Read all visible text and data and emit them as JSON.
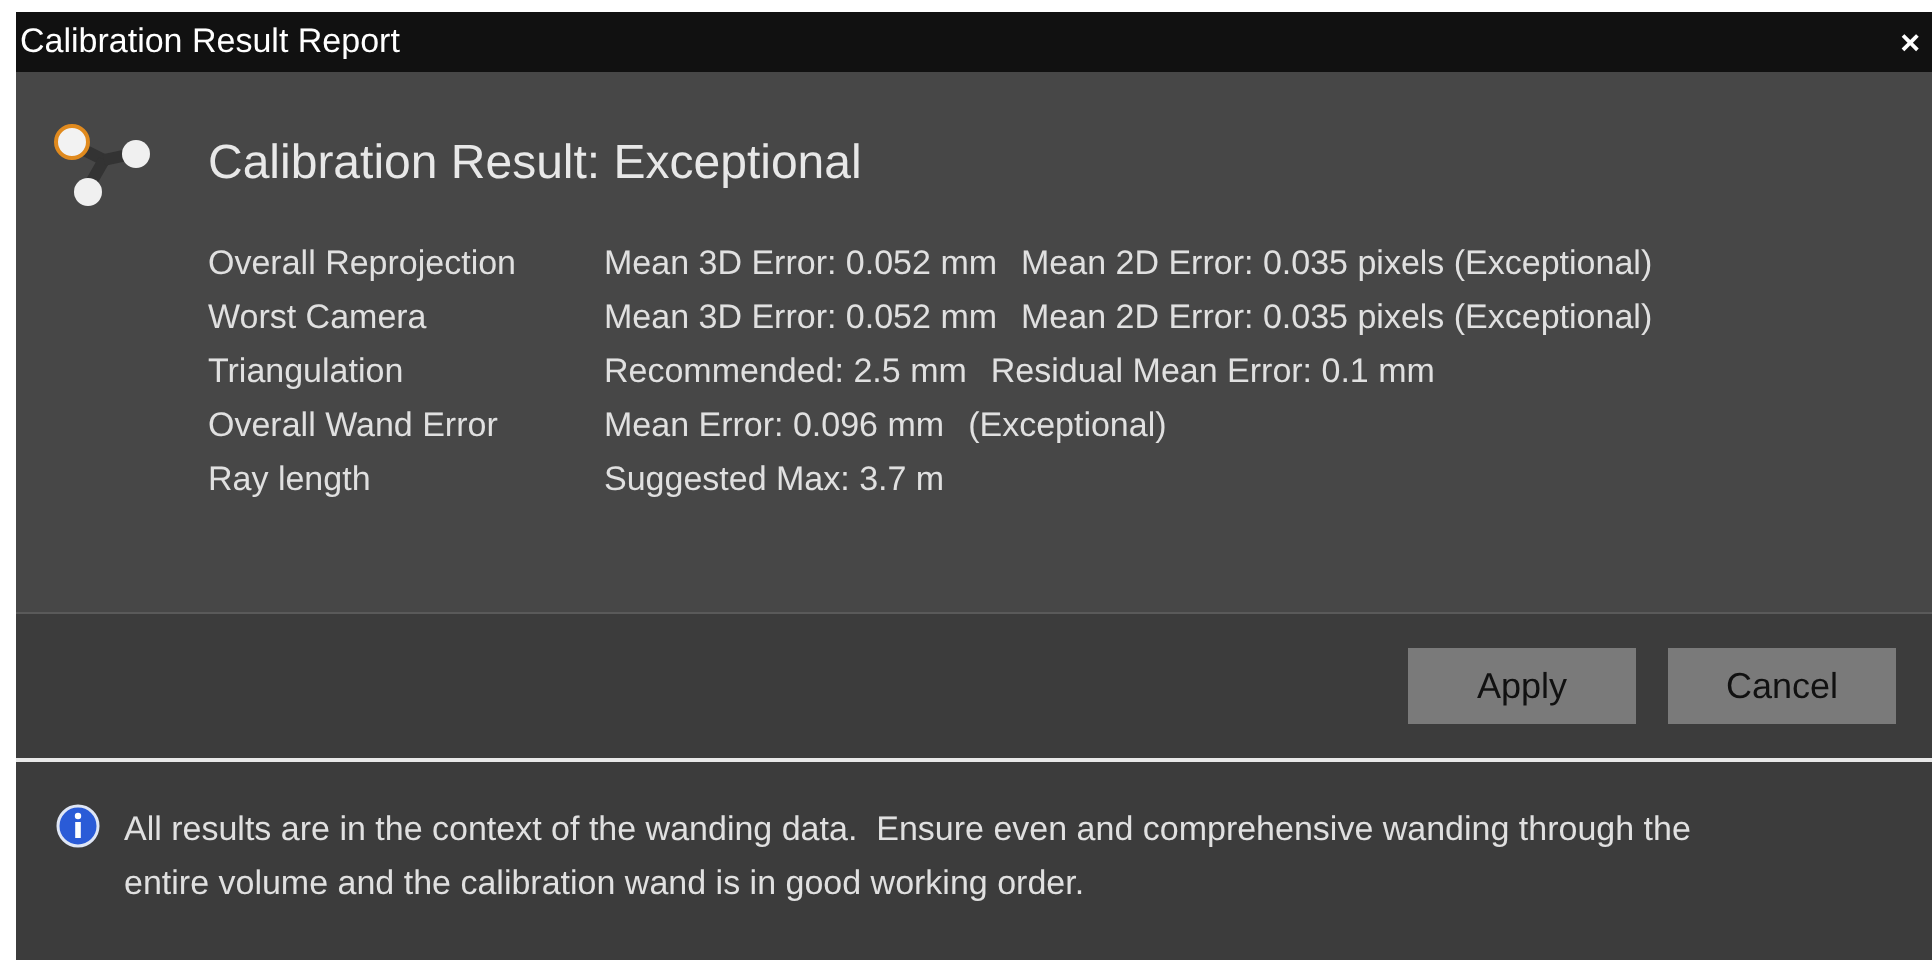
{
  "window": {
    "title": "Calibration Result Report",
    "close": "×"
  },
  "heading": "Calibration Result: Exceptional",
  "results": [
    {
      "label": "Overall Reprojection",
      "values": [
        "Mean 3D Error: 0.052 mm",
        "Mean 2D Error: 0.035 pixels (Exceptional)"
      ]
    },
    {
      "label": "Worst Camera",
      "values": [
        "Mean 3D Error: 0.052 mm",
        "Mean 2D Error: 0.035 pixels (Exceptional)"
      ]
    },
    {
      "label": "Triangulation",
      "values": [
        "Recommended: 2.5 mm",
        "Residual Mean Error: 0.1 mm"
      ]
    },
    {
      "label": "Overall Wand Error",
      "values": [
        "Mean Error: 0.096 mm",
        "(Exceptional)"
      ]
    },
    {
      "label": "Ray length",
      "values": [
        "Suggested Max: 3.7 m"
      ]
    }
  ],
  "buttons": [
    "Apply",
    "Cancel"
  ],
  "info": "All results are in the context of the wanding data.  Ensure even and comprehensive wanding through the entire volume and the calibration wand is in good working order."
}
